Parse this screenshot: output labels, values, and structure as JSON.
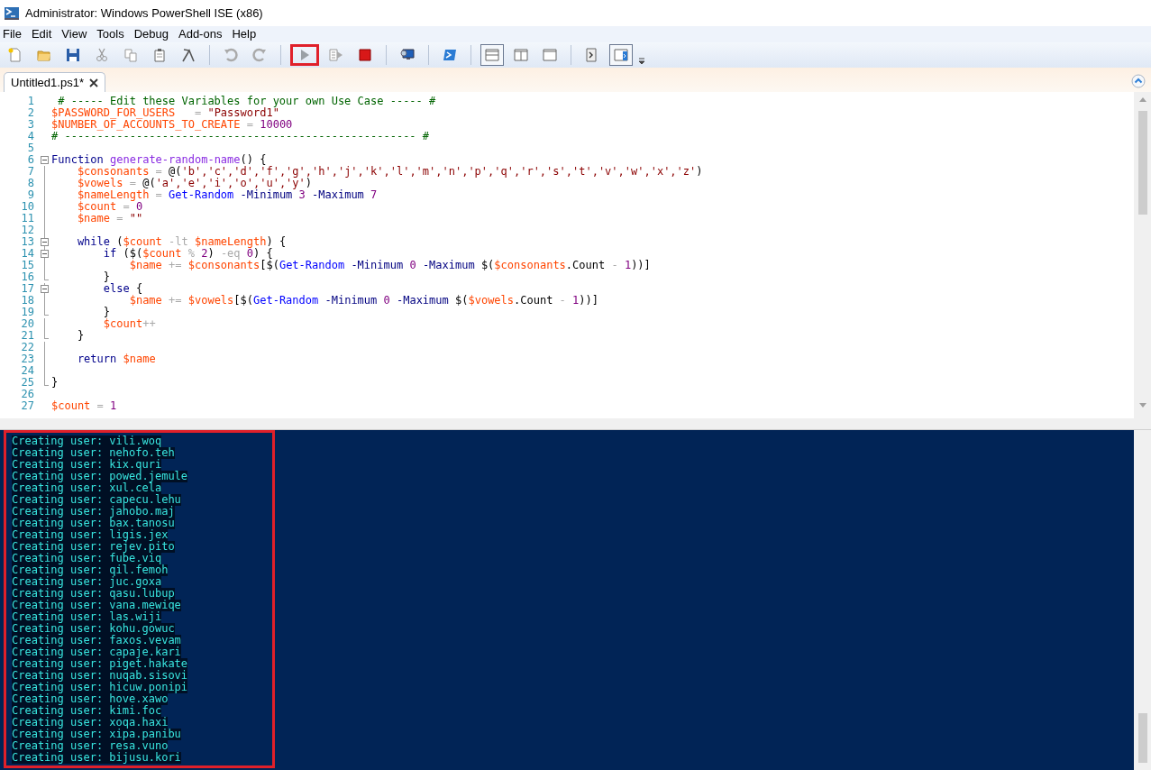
{
  "window": {
    "title": "Administrator: Windows PowerShell ISE (x86)"
  },
  "menu": [
    "File",
    "Edit",
    "View",
    "Tools",
    "Debug",
    "Add-ons",
    "Help"
  ],
  "toolbar": [
    {
      "kind": "button",
      "highlighted": false,
      "pressed": false
    },
    {
      "kind": "button",
      "highlighted": false,
      "pressed": false
    },
    {
      "kind": "button",
      "highlighted": false,
      "pressed": false
    },
    {
      "kind": "button",
      "highlighted": false,
      "pressed": false
    },
    {
      "kind": "button",
      "highlighted": false,
      "pressed": false
    },
    {
      "kind": "button",
      "highlighted": false,
      "pressed": false
    },
    {
      "kind": "button",
      "highlighted": false,
      "pressed": false
    },
    {
      "kind": "separator"
    },
    {
      "kind": "button",
      "highlighted": false,
      "pressed": false
    },
    {
      "kind": "button",
      "highlighted": false,
      "pressed": false
    },
    {
      "kind": "separator"
    },
    {
      "kind": "button",
      "highlighted": true,
      "pressed": false
    },
    {
      "kind": "button",
      "highlighted": false,
      "pressed": false
    },
    {
      "kind": "button",
      "highlighted": false,
      "pressed": false
    },
    {
      "kind": "separator"
    },
    {
      "kind": "button",
      "highlighted": false,
      "pressed": false
    },
    {
      "kind": "separator"
    },
    {
      "kind": "button",
      "highlighted": false,
      "pressed": false
    },
    {
      "kind": "separator"
    },
    {
      "kind": "button",
      "highlighted": false,
      "pressed": true
    },
    {
      "kind": "button",
      "highlighted": false,
      "pressed": false
    },
    {
      "kind": "button",
      "highlighted": false,
      "pressed": false
    },
    {
      "kind": "separator"
    },
    {
      "kind": "button",
      "highlighted": false,
      "pressed": false
    },
    {
      "kind": "button",
      "highlighted": false,
      "pressed": true
    }
  ],
  "tabs": [
    {
      "label": "Untitled1.ps1*",
      "selected": true
    }
  ],
  "editor": {
    "lines": [
      {
        "number": "1",
        "fold_box": false,
        "fold_end": false,
        "tokens": [
          {
            "kind": "comment",
            "text": " # ----- Edit these Variables for your own Use Case ----- #"
          }
        ]
      },
      {
        "number": "2",
        "fold_box": false,
        "fold_end": false,
        "tokens": [
          {
            "kind": "variable",
            "text": "$PASSWORD_FOR_USERS"
          },
          {
            "kind": "operator",
            "text": "   = "
          },
          {
            "kind": "string",
            "text": "\"Password1\""
          }
        ]
      },
      {
        "number": "3",
        "fold_box": false,
        "fold_end": false,
        "tokens": [
          {
            "kind": "variable",
            "text": "$NUMBER_OF_ACCOUNTS_TO_CREATE"
          },
          {
            "kind": "operator",
            "text": " = "
          },
          {
            "kind": "number",
            "text": "10000"
          }
        ]
      },
      {
        "number": "4",
        "fold_box": false,
        "fold_end": false,
        "tokens": [
          {
            "kind": "comment",
            "text": "# ------------------------------------------------------ #"
          }
        ]
      },
      {
        "number": "5",
        "fold_box": false,
        "fold_end": false
      },
      {
        "number": "6",
        "fold_box": true,
        "fold_end": false,
        "tokens": [
          {
            "kind": "keyword",
            "text": "Function "
          },
          {
            "kind": "function",
            "text": "generate-random-name"
          },
          {
            "kind": "plain",
            "text": "() {"
          }
        ]
      },
      {
        "number": "7",
        "fold_box": false,
        "fold_end": false,
        "tokens": [
          {
            "kind": "variable",
            "text": "    $consonants"
          },
          {
            "kind": "operator",
            "text": " = "
          },
          {
            "kind": "plain",
            "text": "@("
          },
          {
            "kind": "string",
            "text": "'b','c','d','f','g','h','j','k','l','m','n','p','q','r','s','t','v','w','x','z'"
          },
          {
            "kind": "plain",
            "text": ")"
          }
        ]
      },
      {
        "number": "8",
        "fold_box": false,
        "fold_end": false,
        "tokens": [
          {
            "kind": "variable",
            "text": "    $vowels"
          },
          {
            "kind": "operator",
            "text": " = "
          },
          {
            "kind": "plain",
            "text": "@("
          },
          {
            "kind": "string",
            "text": "'a','e','i','o','u','y'"
          },
          {
            "kind": "plain",
            "text": ")"
          }
        ]
      },
      {
        "number": "9",
        "fold_box": false,
        "fold_end": false,
        "tokens": [
          {
            "kind": "variable",
            "text": "    $nameLength"
          },
          {
            "kind": "operator",
            "text": " = "
          },
          {
            "kind": "command",
            "text": "Get-Random "
          },
          {
            "kind": "parameter",
            "text": "-Minimum "
          },
          {
            "kind": "number",
            "text": "3 "
          },
          {
            "kind": "parameter",
            "text": "-Maximum "
          },
          {
            "kind": "number",
            "text": "7"
          }
        ]
      },
      {
        "number": "10",
        "fold_box": false,
        "fold_end": false,
        "tokens": [
          {
            "kind": "variable",
            "text": "    $count"
          },
          {
            "kind": "operator",
            "text": " = "
          },
          {
            "kind": "number",
            "text": "0"
          }
        ]
      },
      {
        "number": "11",
        "fold_box": false,
        "fold_end": false,
        "tokens": [
          {
            "kind": "variable",
            "text": "    $name"
          },
          {
            "kind": "operator",
            "text": " = "
          },
          {
            "kind": "string",
            "text": "\"\""
          }
        ]
      },
      {
        "number": "12",
        "fold_box": false,
        "fold_end": false
      },
      {
        "number": "13",
        "fold_box": true,
        "fold_end": false,
        "tokens": [
          {
            "kind": "keyword",
            "text": "    while"
          },
          {
            "kind": "plain",
            "text": " ("
          },
          {
            "kind": "variable",
            "text": "$count"
          },
          {
            "kind": "operator",
            "text": " -lt "
          },
          {
            "kind": "variable",
            "text": "$nameLength"
          },
          {
            "kind": "plain",
            "text": ") {"
          }
        ]
      },
      {
        "number": "14",
        "fold_box": true,
        "fold_end": false,
        "tokens": [
          {
            "kind": "keyword",
            "text": "        if"
          },
          {
            "kind": "plain",
            "text": " ($("
          },
          {
            "kind": "variable",
            "text": "$count"
          },
          {
            "kind": "operator",
            "text": " % "
          },
          {
            "kind": "number",
            "text": "2"
          },
          {
            "kind": "plain",
            "text": ") "
          },
          {
            "kind": "operator",
            "text": "-eq "
          },
          {
            "kind": "number",
            "text": "0"
          },
          {
            "kind": "plain",
            "text": ") {"
          }
        ]
      },
      {
        "number": "15",
        "fold_box": false,
        "fold_end": false,
        "tokens": [
          {
            "kind": "variable",
            "text": "            $name"
          },
          {
            "kind": "operator",
            "text": " += "
          },
          {
            "kind": "variable",
            "text": "$consonants"
          },
          {
            "kind": "plain",
            "text": "[$("
          },
          {
            "kind": "command",
            "text": "Get-Random "
          },
          {
            "kind": "parameter",
            "text": "-Minimum "
          },
          {
            "kind": "number",
            "text": "0 "
          },
          {
            "kind": "parameter",
            "text": "-Maximum"
          },
          {
            "kind": "plain",
            "text": " $("
          },
          {
            "kind": "variable",
            "text": "$consonants"
          },
          {
            "kind": "plain",
            "text": ".Count"
          },
          {
            "kind": "operator",
            "text": " - "
          },
          {
            "kind": "number",
            "text": "1"
          },
          {
            "kind": "plain",
            "text": "))]"
          }
        ]
      },
      {
        "number": "16",
        "fold_box": false,
        "fold_end": true,
        "tokens": [
          {
            "kind": "plain",
            "text": "        }"
          }
        ]
      },
      {
        "number": "17",
        "fold_box": true,
        "fold_end": false,
        "tokens": [
          {
            "kind": "keyword",
            "text": "        else"
          },
          {
            "kind": "plain",
            "text": " {"
          }
        ]
      },
      {
        "number": "18",
        "fold_box": false,
        "fold_end": false,
        "tokens": [
          {
            "kind": "variable",
            "text": "            $name"
          },
          {
            "kind": "operator",
            "text": " += "
          },
          {
            "kind": "variable",
            "text": "$vowels"
          },
          {
            "kind": "plain",
            "text": "[$("
          },
          {
            "kind": "command",
            "text": "Get-Random "
          },
          {
            "kind": "parameter",
            "text": "-Minimum "
          },
          {
            "kind": "number",
            "text": "0 "
          },
          {
            "kind": "parameter",
            "text": "-Maximum"
          },
          {
            "kind": "plain",
            "text": " $("
          },
          {
            "kind": "variable",
            "text": "$vowels"
          },
          {
            "kind": "plain",
            "text": ".Count"
          },
          {
            "kind": "operator",
            "text": " - "
          },
          {
            "kind": "number",
            "text": "1"
          },
          {
            "kind": "plain",
            "text": "))]"
          }
        ]
      },
      {
        "number": "19",
        "fold_box": false,
        "fold_end": true,
        "tokens": [
          {
            "kind": "plain",
            "text": "        }"
          }
        ]
      },
      {
        "number": "20",
        "fold_box": false,
        "fold_end": false,
        "tokens": [
          {
            "kind": "variable",
            "text": "        $count"
          },
          {
            "kind": "operator",
            "text": "++"
          }
        ]
      },
      {
        "number": "21",
        "fold_box": false,
        "fold_end": true,
        "tokens": [
          {
            "kind": "plain",
            "text": "    }"
          }
        ]
      },
      {
        "number": "22",
        "fold_box": false,
        "fold_end": false
      },
      {
        "number": "23",
        "fold_box": false,
        "fold_end": false,
        "tokens": [
          {
            "kind": "keyword",
            "text": "    return "
          },
          {
            "kind": "variable",
            "text": "$name"
          }
        ]
      },
      {
        "number": "24",
        "fold_box": false,
        "fold_end": false
      },
      {
        "number": "25",
        "fold_box": false,
        "fold_end": true,
        "tokens": [
          {
            "kind": "plain",
            "text": "}"
          }
        ]
      },
      {
        "number": "26",
        "fold_box": false,
        "fold_end": false
      },
      {
        "number": "27",
        "fold_box": false,
        "fold_end": false,
        "tokens": [
          {
            "kind": "variable",
            "text": "$count"
          },
          {
            "kind": "operator",
            "text": " = "
          },
          {
            "kind": "number",
            "text": "1"
          }
        ]
      }
    ]
  },
  "console": {
    "highlighted": true,
    "lines": [
      "Creating user: vili.woq",
      "Creating user: nehofo.teh",
      "Creating user: kix.quri",
      "Creating user: powed.jemule",
      "Creating user: xul.cela",
      "Creating user: capecu.lehu",
      "Creating user: jahobo.maj",
      "Creating user: bax.tanosu",
      "Creating user: ligis.jex",
      "Creating user: rejev.pito",
      "Creating user: fube.viq",
      "Creating user: qil.femoh",
      "Creating user: juc.goxa",
      "Creating user: qasu.lubup",
      "Creating user: vana.mewiqe",
      "Creating user: las.wiji",
      "Creating user: kohu.gowuc",
      "Creating user: faxos.vevam",
      "Creating user: capaje.kari",
      "Creating user: piget.hakate",
      "Creating user: nuqab.sisovi",
      "Creating user: hicuw.ponipi",
      "Creating user: hove.xawo",
      "Creating user: kimi.foc",
      "Creating user: xoqa.haxi",
      "Creating user: xipa.panibu",
      "Creating user: resa.vuno",
      "Creating user: bijusu.kori"
    ]
  }
}
